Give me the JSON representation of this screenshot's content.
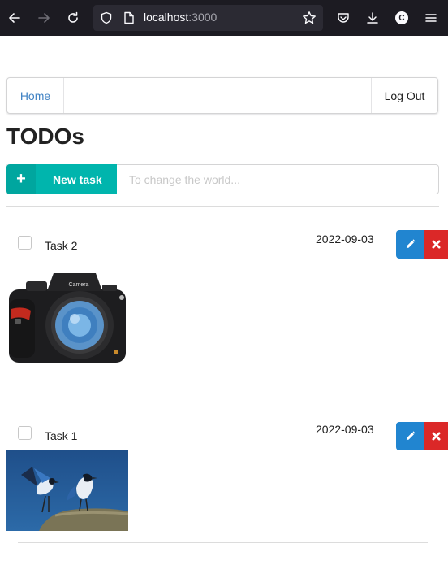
{
  "browser": {
    "url_host": "localhost",
    "url_port": ":3000",
    "profile_initial": "C"
  },
  "nav": {
    "home_label": "Home",
    "logout_label": "Log Out"
  },
  "page": {
    "title": "TODOs"
  },
  "new_task": {
    "button_label": "New task",
    "input_placeholder": "To change the world...",
    "input_value": ""
  },
  "tasks": [
    {
      "title": "Task 2",
      "date": "2022-09-03",
      "checked": false,
      "image": "camera",
      "image_text": "Camera"
    },
    {
      "title": "Task 1",
      "date": "2022-09-03",
      "checked": false,
      "image": "birds"
    }
  ],
  "colors": {
    "teal": "#00b5ad",
    "blue": "#2185d0",
    "red": "#db2828",
    "link": "#4183c4"
  }
}
